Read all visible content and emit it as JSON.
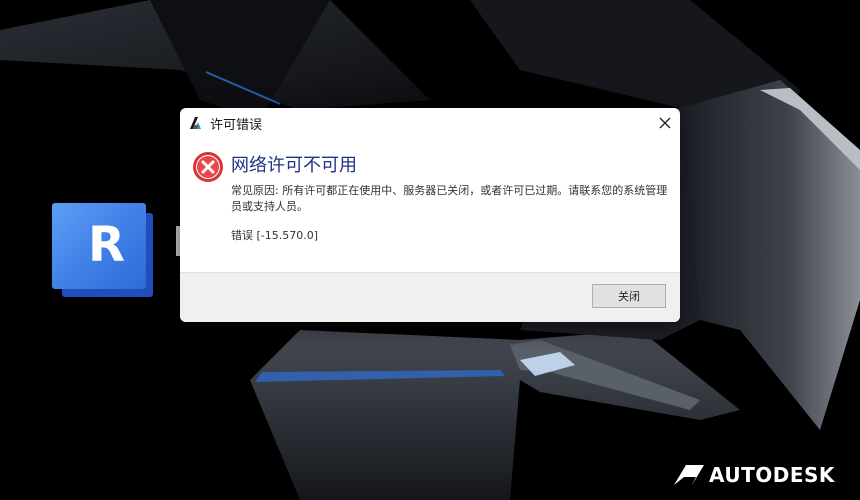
{
  "splash": {
    "app_logo_letter": "R",
    "brand_name": "AUTODESK"
  },
  "dialog": {
    "title": "许可错误",
    "heading": "网络许可不可用",
    "message": "常见原因: 所有许可都正在使用中、服务器已关闭，或者许可已过期。请联系您的系统管理员或支持人员。",
    "error_code": "错误 [-15.570.0]",
    "close_button_label": "关闭"
  },
  "icons": {
    "title_icon": "autodesk-a-icon",
    "error_icon": "error-x-circle-icon",
    "close_icon": "close-icon",
    "brand_icon": "autodesk-logo-icon"
  },
  "colors": {
    "heading": "#1e3287",
    "error_icon": "#d9333a",
    "app_logo": "#3f7fe6",
    "footer": "#f0f0f0"
  }
}
